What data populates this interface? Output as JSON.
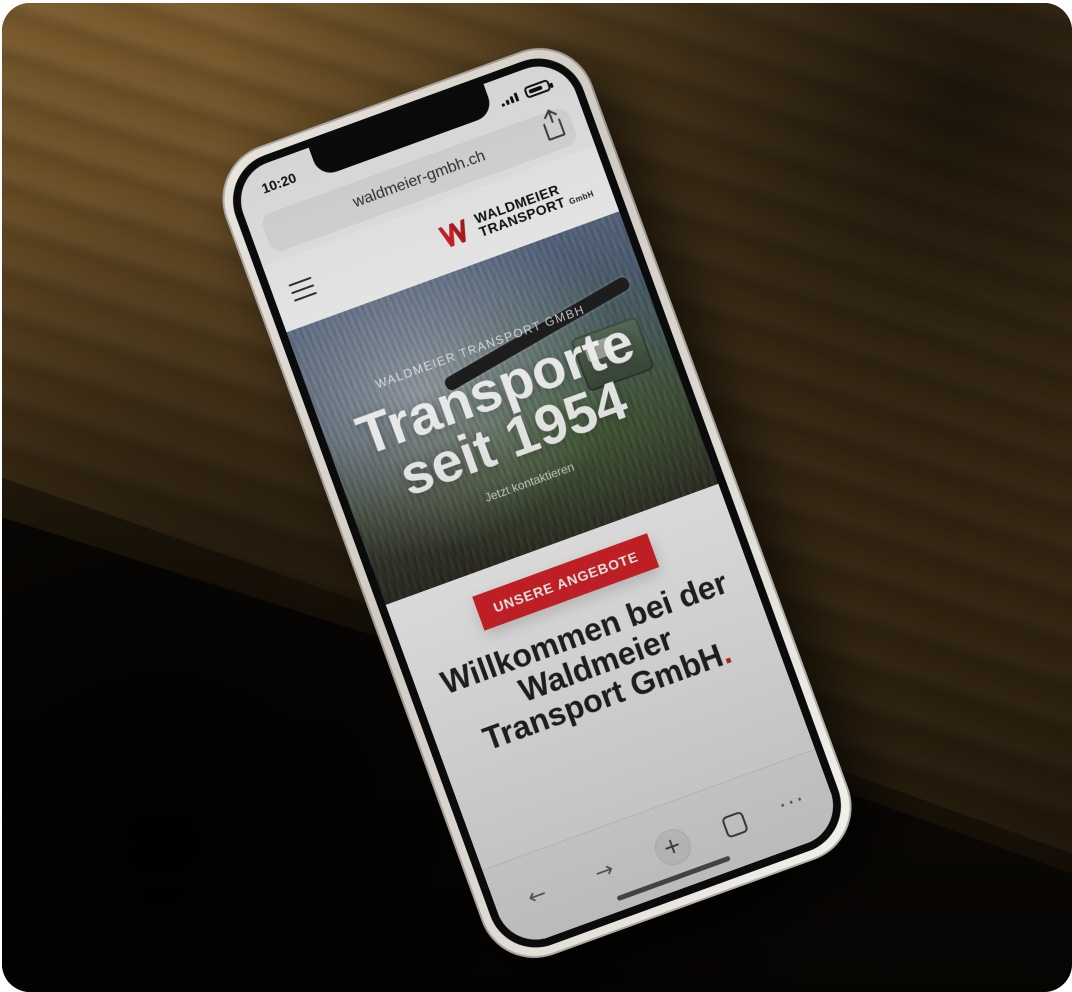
{
  "scene": {
    "phone_status_time": "10:20",
    "address_bar_text": "waldmeier-gmbh.ch",
    "logo": {
      "line1": "WALDMEIER",
      "line2": "TRANSPORT",
      "suffix": "GmbH"
    },
    "hero": {
      "kicker": "WALDMEIER TRANSPORT GMBH",
      "title_line1": "Transporte",
      "title_line2": "seit 1954",
      "cta": "Jetzt kontaktieren"
    },
    "section": {
      "tag": "UNSERE ANGEBOTE",
      "welcome_line1": "Willkommen bei der",
      "welcome_line2": "Waldmeier",
      "welcome_line3": "Transport GmbH"
    },
    "browser_controls": {
      "back": "←",
      "forward": "→",
      "new": "+",
      "more": "···"
    },
    "colors": {
      "brand_red": "#d6232a"
    },
    "icons": {
      "share": "share-icon",
      "menu": "hamburger-menu-icon",
      "tabs": "tabs-icon"
    }
  }
}
